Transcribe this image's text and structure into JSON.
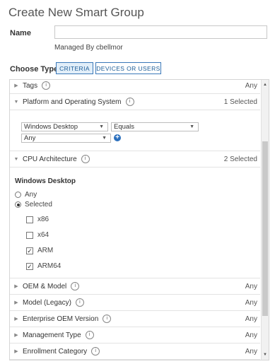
{
  "header": {
    "title": "Create New Smart Group"
  },
  "name_field": {
    "label": "Name",
    "value": "",
    "placeholder": ""
  },
  "managed_by": "Managed By cbellmor",
  "choose_type": {
    "label": "Choose Type",
    "criteria": "CRITERIA",
    "devices_or_users": "DEVICES OR USERS",
    "selected": "CRITERIA"
  },
  "criteria": {
    "tags": {
      "name": "Tags",
      "value": "Any"
    },
    "platform": {
      "name": "Platform and Operating System",
      "value": "1 Selected",
      "platform_select": "Windows Desktop",
      "operator_select": "Equals",
      "version_select": "Any"
    },
    "cpu": {
      "name": "CPU Architecture",
      "value": "2 Selected",
      "subheading": "Windows Desktop",
      "radio_any": "Any",
      "radio_selected": "Selected",
      "selected_option": "Selected",
      "options": [
        {
          "label": "x86",
          "checked": false
        },
        {
          "label": "x64",
          "checked": false
        },
        {
          "label": "ARM",
          "checked": true
        },
        {
          "label": "ARM64",
          "checked": true
        }
      ]
    },
    "collapsed": [
      {
        "name": "OEM & Model",
        "value": "Any"
      },
      {
        "name": "Model (Legacy)",
        "value": "Any"
      },
      {
        "name": "Enterprise OEM Version",
        "value": "Any"
      },
      {
        "name": "Management Type",
        "value": "Any"
      },
      {
        "name": "Enrollment Category",
        "value": "Any"
      }
    ]
  },
  "icons": {
    "collapsed": "triangle-right",
    "expanded": "triangle-down",
    "info": "info-circle",
    "add": "plus-circle"
  }
}
